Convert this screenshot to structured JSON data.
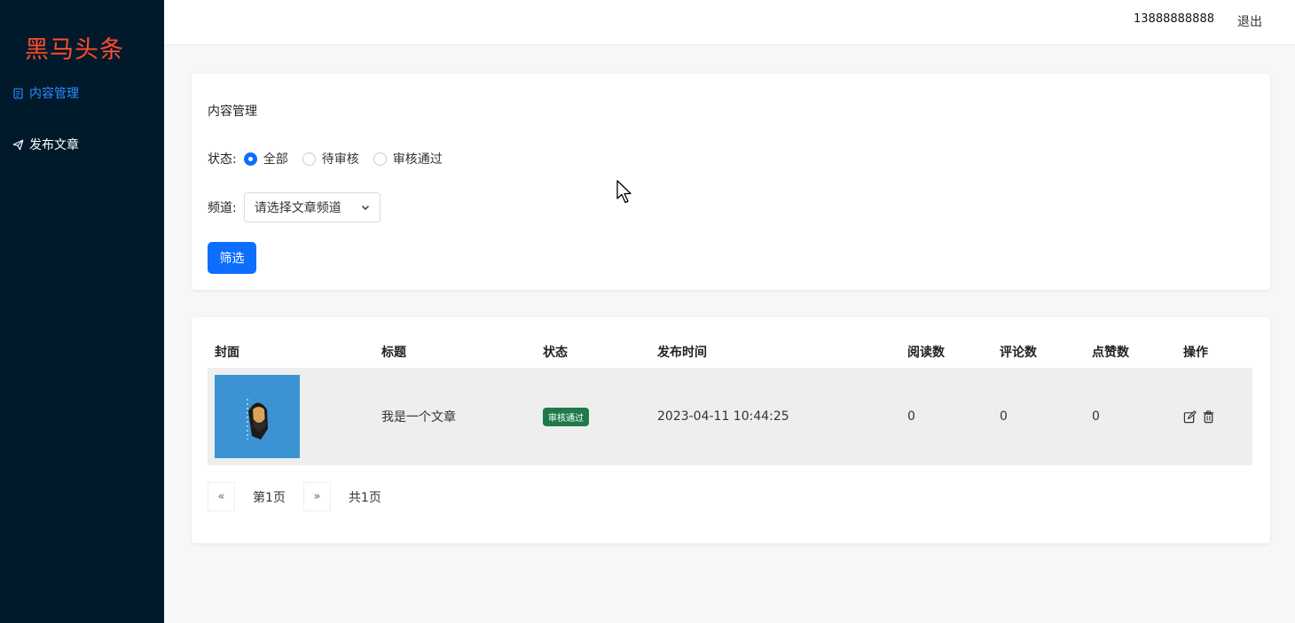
{
  "brand": "黑马头条",
  "sidebar": {
    "items": [
      {
        "label": "内容管理",
        "icon": "document-icon",
        "active": true
      },
      {
        "label": "发布文章",
        "icon": "send-icon",
        "active": false
      }
    ]
  },
  "header": {
    "user_phone": "13888888888",
    "logout_label": "退出"
  },
  "filter": {
    "card_title": "内容管理",
    "status_label": "状态:",
    "status_options": [
      "全部",
      "待审核",
      "审核通过"
    ],
    "status_selected": "全部",
    "channel_label": "频道:",
    "channel_select_value": "请选择文章频道",
    "submit_label": "筛选"
  },
  "table": {
    "columns": [
      "封面",
      "标题",
      "状态",
      "发布时间",
      "阅读数",
      "评论数",
      "点赞数",
      "操作"
    ],
    "rows": [
      {
        "title": "我是一个文章",
        "status": "审核通过",
        "pubdate": "2023-04-11 10:44:25",
        "read_count": "0",
        "comment_count": "0",
        "like_count": "0"
      }
    ]
  },
  "pagination": {
    "prev_label": "«",
    "current_page_text": "第1页",
    "next_label": "»",
    "total_text": "共1页"
  },
  "colors": {
    "sidebar_bg": "#001a2c",
    "brand": "#ff4c2b",
    "primary": "#0d6efd",
    "badge_success": "#1f7a4a",
    "cover_bg": "#3c93d3"
  }
}
